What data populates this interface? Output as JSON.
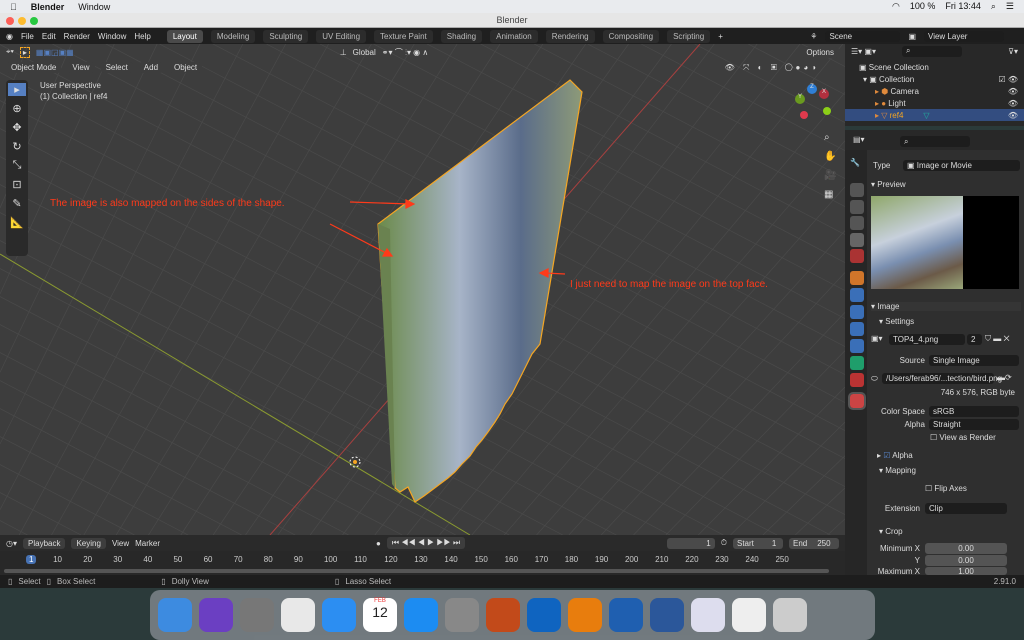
{
  "macos": {
    "app": "Blender",
    "menu": "Window",
    "battery": "100 %",
    "clock": "Fri 13:44"
  },
  "window": {
    "title": "Blender"
  },
  "topbar": {
    "menus": [
      "File",
      "Edit",
      "Render",
      "Window",
      "Help"
    ],
    "workspaces": [
      "Layout",
      "Modeling",
      "Sculpting",
      "UV Editing",
      "Texture Paint",
      "Shading",
      "Animation",
      "Rendering",
      "Compositing",
      "Scripting",
      "+"
    ],
    "active_workspace": "Layout",
    "scene": "Scene",
    "view_layer": "View Layer"
  },
  "viewport": {
    "mode": "Object Mode",
    "menus": [
      "View",
      "Select",
      "Add",
      "Object"
    ],
    "orientation": "Global",
    "options": "Options",
    "perspective": "User Perspective",
    "collection_info": "(1) Collection | ref4",
    "gizmo": {
      "x": "X",
      "y": "Y",
      "z": "Z"
    },
    "annotations": [
      "The image is also mapped on the sides of the shape.",
      "I just need to map the image on the top face."
    ],
    "annotation_color": "#ff3a1a",
    "selection_color": "#f5a623"
  },
  "outliner": {
    "root": "Scene Collection",
    "collection": "Collection",
    "items": [
      {
        "name": "Camera",
        "selected": false
      },
      {
        "name": "Light",
        "selected": false
      },
      {
        "name": "ref4",
        "selected": true
      }
    ]
  },
  "properties": {
    "type_label": "Type",
    "type_value": "Image or Movie",
    "preview": "Preview",
    "image": "Image",
    "settings": "Settings",
    "image_name": "TOP4_4.png",
    "users": "2",
    "source_label": "Source",
    "source_value": "Single Image",
    "filepath": "/Users/ferab96/...tection/bird.png",
    "info": "746 x 576,  RGB byte",
    "colorspace_label": "Color Space",
    "colorspace_value": "sRGB",
    "alpha_label": "Alpha",
    "alpha_value": "Straight",
    "view_as_render": "View as Render",
    "alpha_panel": "Alpha",
    "alpha_checked": true,
    "mapping": "Mapping",
    "flip_axes": "Flip Axes",
    "extension_label": "Extension",
    "extension_value": "Clip",
    "crop": "Crop",
    "min_x_label": "Minimum X",
    "min_x": "0.00",
    "y_label": "Y",
    "min_y": "0.00",
    "max_x_label": "Maximum X",
    "max_x": "1.00"
  },
  "timeline": {
    "menus": [
      "Playback",
      "Keying",
      "View",
      "Marker"
    ],
    "current_frame": "1",
    "start_label": "Start",
    "start": "1",
    "end_label": "End",
    "end": "250",
    "ticks": [
      "1",
      "10",
      "20",
      "30",
      "40",
      "50",
      "60",
      "70",
      "80",
      "90",
      "100",
      "110",
      "120",
      "130",
      "140",
      "150",
      "160",
      "170",
      "180",
      "190",
      "200",
      "210",
      "220",
      "230",
      "240",
      "250"
    ]
  },
  "status": {
    "items": [
      "Select",
      "Box Select",
      "Dolly View",
      "Lasso Select"
    ],
    "version": "2.91.0"
  },
  "dock": {
    "apps": [
      "Finder",
      "Siri",
      "Launchpad",
      "Chrome",
      "Safari",
      "Calendar",
      "App Store",
      "System Preferences",
      "MATLAB",
      "Outlook",
      "Blender",
      "Forticlient",
      "Word",
      "Window",
      "Window",
      "Trash"
    ],
    "calendar_month": "FEB",
    "calendar_day": "12"
  }
}
